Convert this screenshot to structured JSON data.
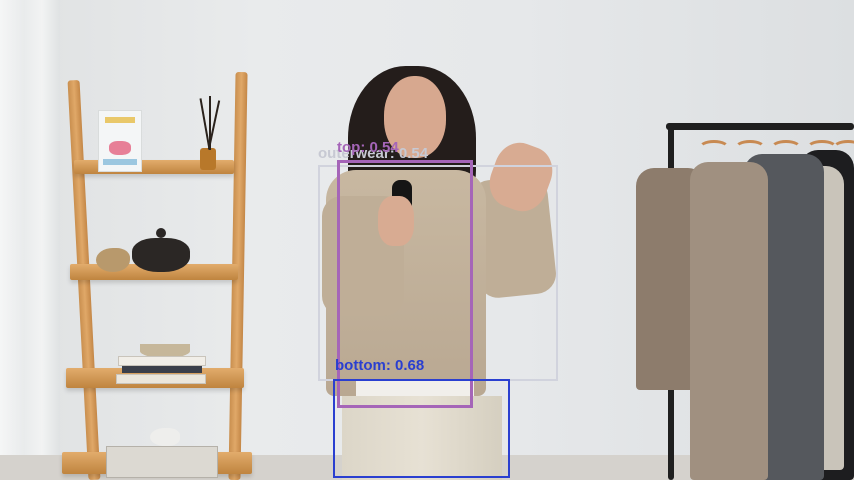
{
  "detections": [
    {
      "name": "outerwear",
      "label": "outerwear: 0.54",
      "color": "#d1d3dd"
    },
    {
      "name": "top",
      "label": "top: 0.54",
      "color": "#a565b8"
    },
    {
      "name": "bottom",
      "label": "bottom: 0.68",
      "color": "#2a3fd0"
    }
  ]
}
